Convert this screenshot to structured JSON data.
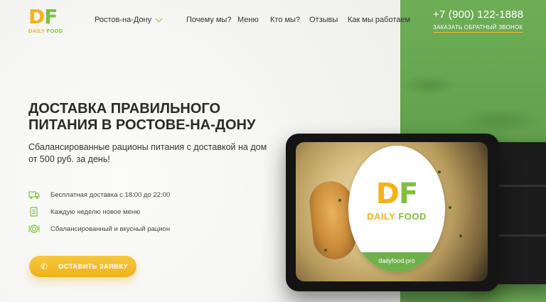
{
  "logo": {
    "letter_1": "D",
    "letter_2": "F",
    "word_1": "DAILY",
    "word_2": "FOOD"
  },
  "header": {
    "city": "Ростов-на-Дону",
    "nav": [
      "Почему мы?",
      "Меню",
      "Кто мы?",
      "Отзывы",
      "Как мы работаем"
    ],
    "phone": "+7 (900) 122-1888",
    "callback": "Заказать обратный звонок"
  },
  "hero": {
    "title": "ДОСТАВКА ПРАВИЛЬНОГО ПИТАНИЯ В РОСТОВЕ-НА-ДОНУ",
    "subtitle": "Сбалансированные рационы питания с доставкой на дом от 500 руб. за день!",
    "features": [
      {
        "icon": "truck-icon",
        "text": "Бесплатная доставка с 18:00 до 22:00"
      },
      {
        "icon": "menu-list-icon",
        "text": "Каждую неделю новое меню"
      },
      {
        "icon": "plate-icon",
        "text": "Сбалансированный и вкусный рацион"
      }
    ],
    "cta": {
      "icon": "phone-icon",
      "label": "ОСТАВИТЬ ЗАЯВКУ"
    }
  },
  "product": {
    "label_letter_1": "D",
    "label_letter_2": "F",
    "label_word_1": "DAILY",
    "label_word_2": "FOOD",
    "url": "dailyfood.pro"
  },
  "colors": {
    "yellow": "#f2b31b",
    "green": "#7fbf3f",
    "panel_green": "#64a24e",
    "cta": "#f2bd2c"
  }
}
